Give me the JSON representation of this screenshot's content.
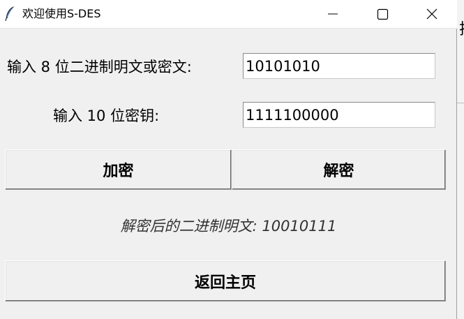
{
  "window": {
    "title": "欢迎使用S-DES",
    "icon": "feather-icon"
  },
  "controls": {
    "minimize_icon": "minimize-icon",
    "maximize_icon": "maximize-icon",
    "close_icon": "close-icon"
  },
  "form": {
    "text_label": "输入 8 位二进制明文或密文:",
    "text_value": "10101010",
    "key_label": "输入 10 位密钥:",
    "key_value": "1111100000"
  },
  "buttons": {
    "encrypt": "加密",
    "decrypt": "解密",
    "home": "返回主页"
  },
  "result": "解密后的二进制明文: 10010111",
  "background_window": {
    "partial_glyph": "拮"
  }
}
